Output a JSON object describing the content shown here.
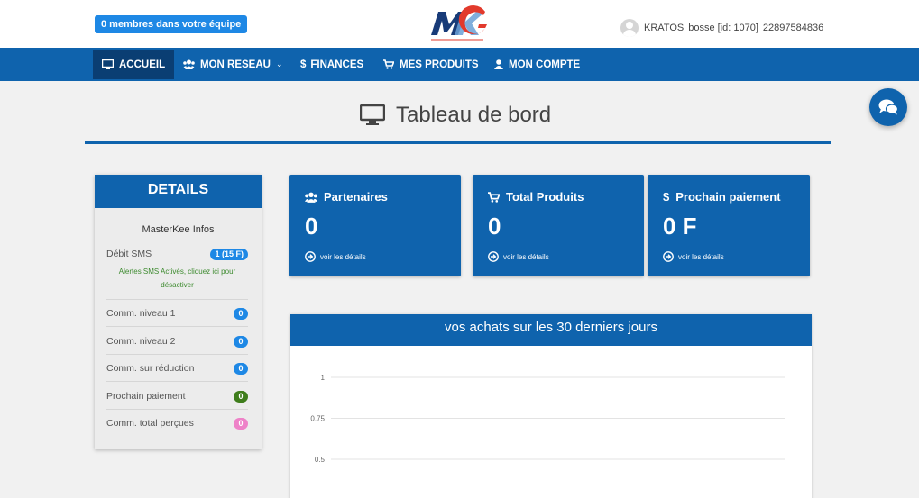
{
  "header": {
    "team_badge": "0 membres dans votre équipe",
    "user_name": "KRATOS",
    "user_handle": "bosse [id: 1070]",
    "user_phone": "22897584836"
  },
  "nav": {
    "items": [
      {
        "label": "ACCUEIL",
        "icon": "monitor-icon"
      },
      {
        "label": "MON RESEAU",
        "icon": "users-icon"
      },
      {
        "label": "FINANCES",
        "icon": "dollar-icon"
      },
      {
        "label": "MES PRODUITS",
        "icon": "cart-icon"
      },
      {
        "label": "MON COMPTE",
        "icon": "user-icon"
      }
    ]
  },
  "page": {
    "title": "Tableau de bord"
  },
  "details": {
    "heading": "DETAILS",
    "subtitle": "MasterKee Infos",
    "sms_label": "Débit SMS",
    "sms_value": "1  (15 F)",
    "sms_note": "Alertes SMS Activés, cliquez ici pour désactiver",
    "rows": [
      {
        "label": "Comm. niveau 1",
        "value": "0",
        "color": "#1e88e5"
      },
      {
        "label": "Comm. niveau 2",
        "value": "0",
        "color": "#1e88e5"
      },
      {
        "label": "Comm. sur réduction",
        "value": "0",
        "color": "#1e88e5"
      },
      {
        "label": "Prochain paiement",
        "value": "0",
        "color": "#3f7d1c"
      },
      {
        "label": "Comm. total perçues",
        "value": "0",
        "color": "#ee82c8"
      }
    ]
  },
  "cards": [
    {
      "title": "Partenaires",
      "value": "0",
      "link": "voir les détails",
      "icon": "users-icon"
    },
    {
      "title": "Total Produits",
      "value": "0",
      "link": "voir les détails",
      "icon": "cart-icon"
    },
    {
      "title": "Prochain paiement",
      "value": "0 F",
      "link": "voir les détails",
      "icon": "dollar-icon"
    }
  ],
  "chart": {
    "title": "vos achats sur les 30 derniers jours"
  },
  "chart_data": {
    "type": "line",
    "title": "vos achats sur les 30 derniers jours",
    "ytick_labels": [
      "1",
      "0.75",
      "0.5"
    ],
    "yticks": [
      1,
      0.75,
      0.5
    ],
    "ylim": [
      0,
      1
    ],
    "grid": true,
    "series": []
  },
  "colors": {
    "primary": "#0f63ad",
    "nav_active": "#0a3e73",
    "badge": "#1e88e5"
  }
}
